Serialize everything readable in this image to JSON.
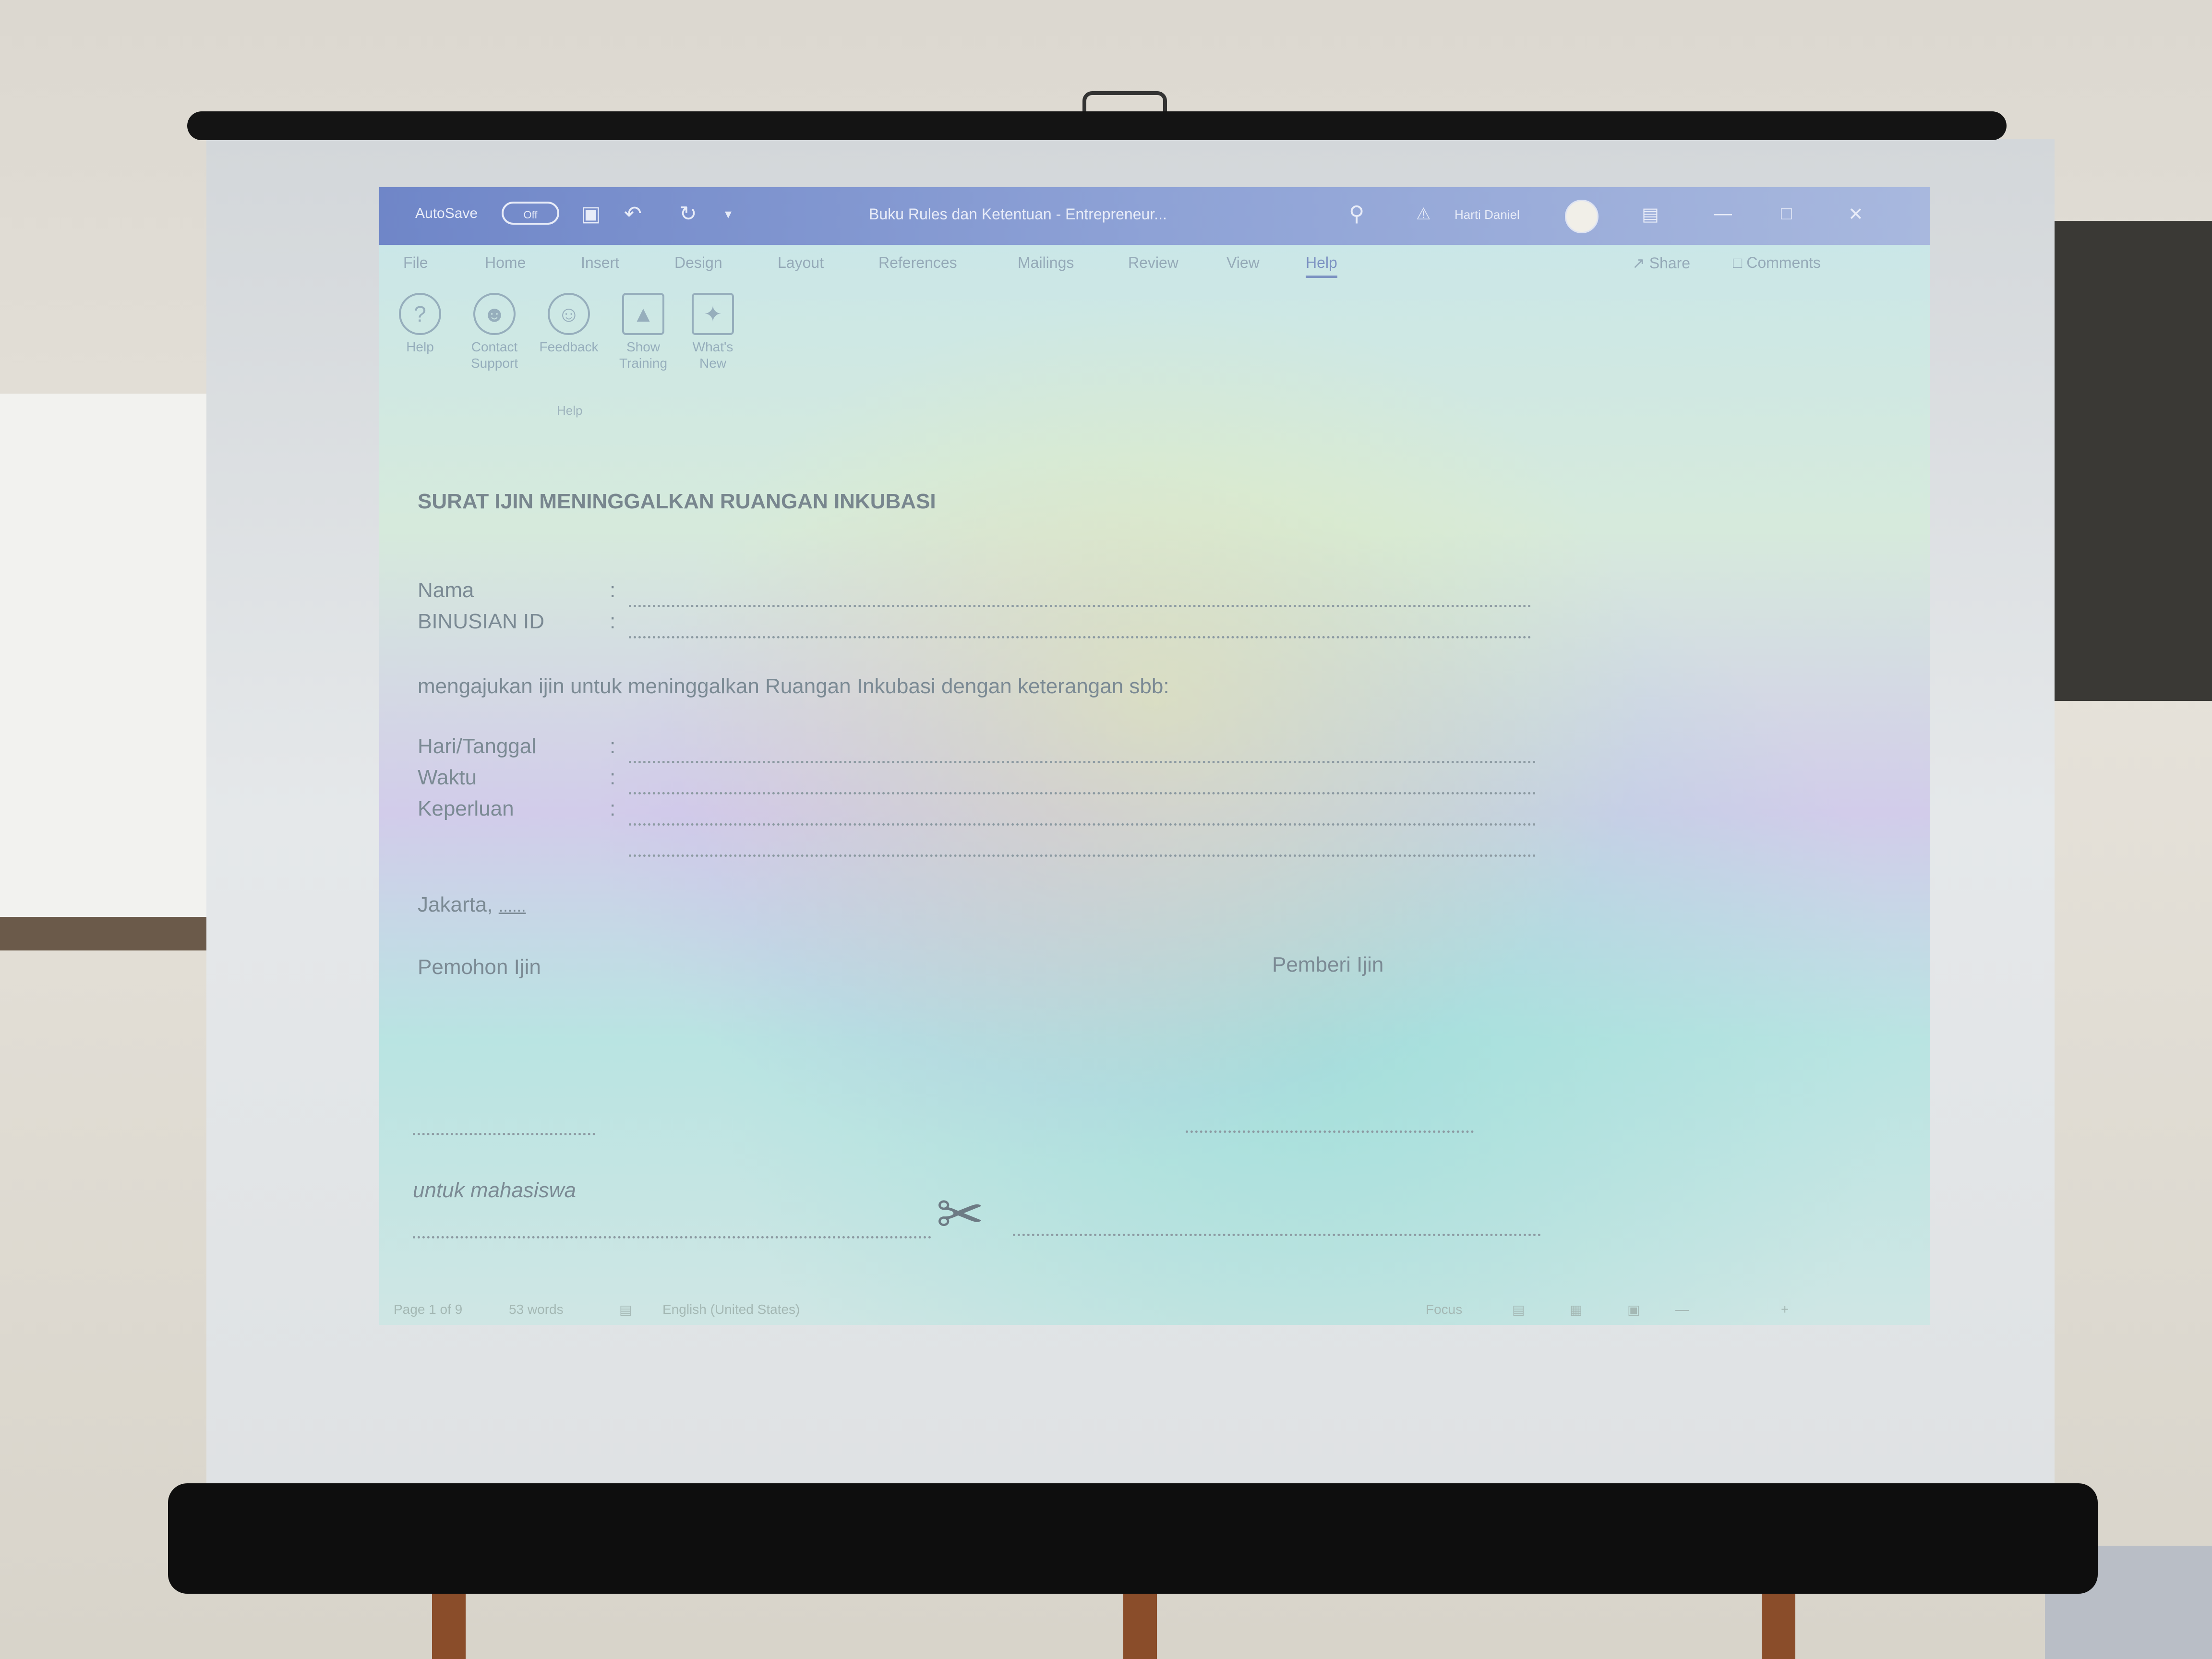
{
  "titlebar": {
    "autosave_label": "AutoSave",
    "autosave_state": "Off",
    "document_title": "Buku Rules dan Ketentuan - Entrepreneur...",
    "user_name": "Harti Daniel"
  },
  "ribbon_tabs": [
    "File",
    "Home",
    "Insert",
    "Design",
    "Layout",
    "References",
    "Mailings",
    "Review",
    "View",
    "Help"
  ],
  "active_tab": "Help",
  "share_label": "Share",
  "comments_label": "Comments",
  "help_group": {
    "buttons": [
      {
        "label_1": "Help",
        "label_2": "",
        "icon": "question-icon"
      },
      {
        "label_1": "Contact",
        "label_2": "Support",
        "icon": "person-icon"
      },
      {
        "label_1": "Feedback",
        "label_2": "",
        "icon": "smiley-icon"
      },
      {
        "label_1": "Show",
        "label_2": "Training",
        "icon": "graduation-cap-icon"
      },
      {
        "label_1": "What's",
        "label_2": "New",
        "icon": "wand-icon"
      }
    ],
    "group_label": "Help"
  },
  "document": {
    "heading": "SURAT IJIN MENINGGALKAN RUANGAN INKUBASI",
    "field_nama": "Nama",
    "field_binusian": "BINUSIAN ID",
    "intro": "mengajukan ijin untuk meninggalkan Ruangan Inkubasi dengan keterangan sbb:",
    "field_hari": "Hari/Tanggal",
    "field_waktu": "Waktu",
    "field_keperluan": "Keperluan",
    "colon": ":",
    "city_date": "Jakarta,",
    "city_date_field": "......",
    "applicant": "Pemohon Ijin",
    "approver": "Pemberi Ijin",
    "footer_note": "untuk mahasiswa"
  },
  "statusbar": {
    "page": "Page 1 of 9",
    "words": "53 words",
    "language": "English (United States)",
    "focus": "Focus"
  },
  "colors": {
    "titlebar": "#7f94cc",
    "screen_frame": "#141414",
    "text": "#7b8a94"
  }
}
